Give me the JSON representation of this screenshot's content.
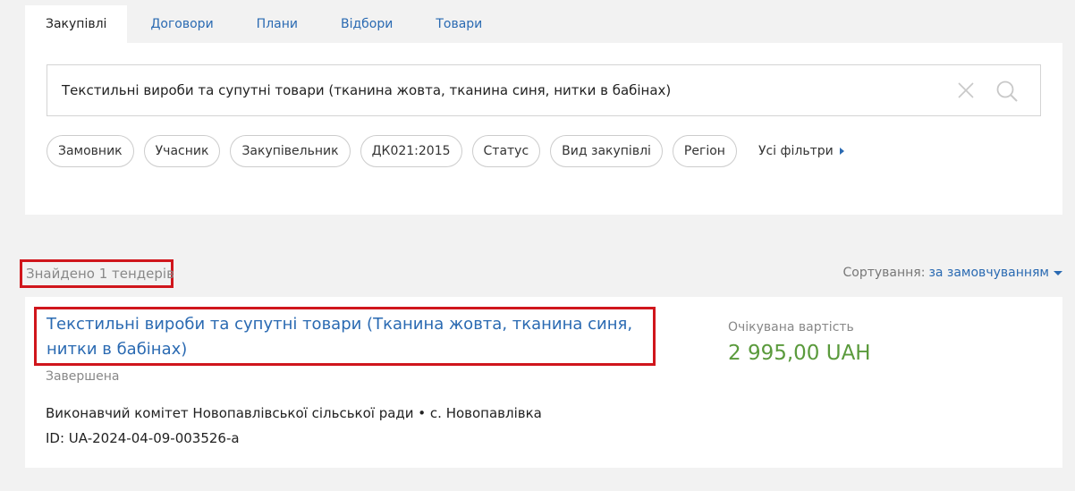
{
  "tabs": [
    {
      "label": "Закупівлі",
      "active": true
    },
    {
      "label": "Договори"
    },
    {
      "label": "Плани"
    },
    {
      "label": "Відбори"
    },
    {
      "label": "Товари"
    }
  ],
  "search": {
    "value": "Текстильні вироби та супутні товари (тканина жовта, тканина синя, нитки в бабінах)"
  },
  "filters": {
    "chips": [
      "Замовник",
      "Учасник",
      "Закупівельник",
      "ДК021:2015",
      "Статус",
      "Вид закупівлі",
      "Регіон"
    ],
    "all_label": "Усі фільтри"
  },
  "results": {
    "found": "Знайдено 1 тендерів",
    "sort_label": "Сортування:",
    "sort_value": "за замовчуванням"
  },
  "tender": {
    "title": "Текстильні вироби та супутні товари (Тканина жовта, тканина синя, нитки в бабінах)",
    "status": "Завершена",
    "buyer": "Виконавчий комітет Новопавлівської сільської ради • с. Новопавлівка",
    "id": "ID: UA-2024-04-09-003526-a",
    "expected_label": "Очікувана вартість",
    "expected_value": "2 995,00 UAH"
  },
  "colors": {
    "link": "#2a6ab2",
    "highlight": "#d0161c",
    "price": "#5a9a3c"
  },
  "icons": [
    "clear-icon",
    "search-icon",
    "triangle-right-icon",
    "triangle-down-icon"
  ]
}
